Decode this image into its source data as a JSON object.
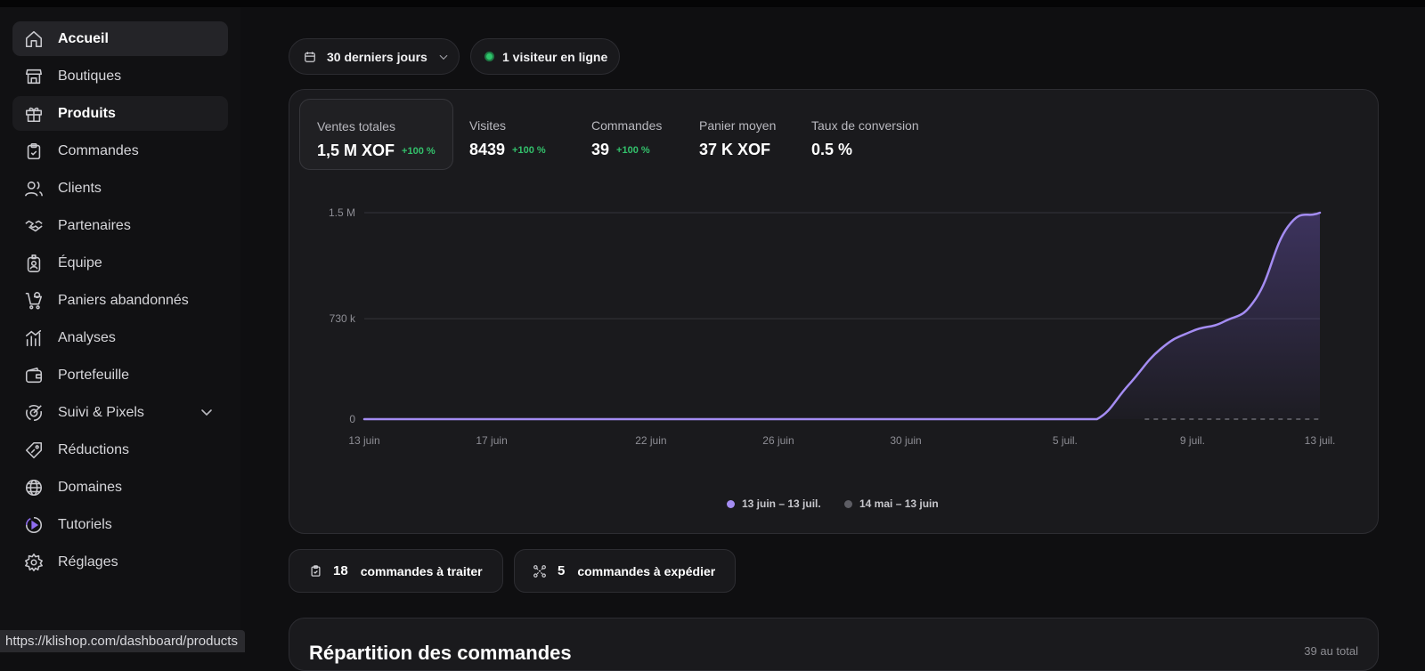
{
  "sidebar": {
    "items": [
      {
        "label": "Accueil",
        "icon": "home-icon"
      },
      {
        "label": "Boutiques",
        "icon": "store-icon"
      },
      {
        "label": "Produits",
        "icon": "gift-icon"
      },
      {
        "label": "Commandes",
        "icon": "clipboard-check-icon"
      },
      {
        "label": "Clients",
        "icon": "users-icon"
      },
      {
        "label": "Partenaires",
        "icon": "handshake-icon"
      },
      {
        "label": "Équipe",
        "icon": "badge-icon"
      },
      {
        "label": "Paniers abandonnés",
        "icon": "cart-icon"
      },
      {
        "label": "Analyses",
        "icon": "analytics-icon"
      },
      {
        "label": "Portefeuille",
        "icon": "wallet-icon"
      },
      {
        "label": "Suivi & Pixels",
        "icon": "target-icon"
      },
      {
        "label": "Réductions",
        "icon": "tag-icon"
      },
      {
        "label": "Domaines",
        "icon": "globe-icon"
      },
      {
        "label": "Tutoriels",
        "icon": "play-circle-icon"
      },
      {
        "label": "Réglages",
        "icon": "settings-icon"
      }
    ],
    "active_item": "Accueil",
    "hover_item": "Produits"
  },
  "status_url": "https://klishop.com/dashboard/products",
  "filters": {
    "period_label": "30 derniers jours",
    "visitors_label": "1 visiteur en ligne"
  },
  "stats": [
    {
      "label": "Ventes totales",
      "value": "1,5 M XOF",
      "delta": "+100 %"
    },
    {
      "label": "Visites",
      "value": "8439",
      "delta": "+100 %"
    },
    {
      "label": "Commandes",
      "value": "39",
      "delta": "+100 %"
    },
    {
      "label": "Panier moyen",
      "value": "37 K XOF",
      "delta": ""
    },
    {
      "label": "Taux de conversion",
      "value": "0.5 %",
      "delta": ""
    }
  ],
  "chart_data": {
    "type": "area",
    "x_ticks": [
      "13 juin",
      "17 juin",
      "22 juin",
      "26 juin",
      "30 juin",
      "5 juil.",
      "9 juil.",
      "13 juil."
    ],
    "y_ticks": [
      "0",
      "730 k",
      "1.5 M"
    ],
    "ylim": [
      0,
      1500000
    ],
    "grid": true,
    "legend_position": "bottom-center",
    "series": [
      {
        "name": "13 juin – 13 juil.",
        "color": "#a48cf2",
        "style": "solid-area",
        "x": [
          "13 juin",
          "5 juil.",
          "6 juil.",
          "7 juil.",
          "8 juil.",
          "9 juil.",
          "10 juil.",
          "11 juil.",
          "12 juil.",
          "13 juil."
        ],
        "values": [
          0,
          0,
          0,
          250000,
          510000,
          640000,
          710000,
          880000,
          1400000,
          1500000
        ]
      },
      {
        "name": "14 mai – 13 juin",
        "color": "#6b6b72",
        "style": "dashed",
        "x": [
          "13 juin",
          "13 juil."
        ],
        "values": [
          0,
          0
        ]
      }
    ]
  },
  "actions": [
    {
      "count": "18",
      "label": "commandes à traiter",
      "icon": "clipboard-check-icon"
    },
    {
      "count": "5",
      "label": "commandes à expédier",
      "icon": "shipping-icon"
    }
  ],
  "breakdown": {
    "title": "Répartition des commandes",
    "total_label": "39 au total"
  }
}
